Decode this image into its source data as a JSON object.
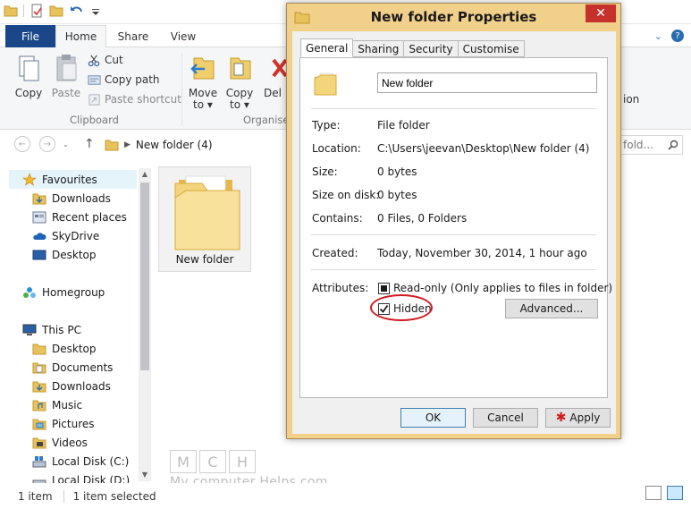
{
  "explorer": {
    "ribbon_tabs": [
      "File",
      "Home",
      "Share",
      "View"
    ],
    "clipboard": {
      "copy": "Copy",
      "paste": "Paste",
      "cut": "Cut",
      "copy_path": "Copy path",
      "paste_shortcut": "Paste shortcut",
      "group_label": "Clipboard"
    },
    "organise": {
      "move_to_1": "Move",
      "move_to_2": "to ▾",
      "copy_to_1": "Copy",
      "copy_to_2": "to ▾",
      "delete": "Del",
      "group_label": "Organise"
    },
    "right_partial": "ion",
    "address": {
      "path": "New folder (4)"
    },
    "search": {
      "placeholder": "fold..."
    },
    "nav": {
      "favourites": "Favourites",
      "downloads": "Downloads",
      "recent": "Recent places",
      "skydrive": "SkyDrive",
      "desktop": "Desktop",
      "homegroup": "Homegroup",
      "this_pc": "This PC",
      "pc_desktop": "Desktop",
      "pc_documents": "Documents",
      "pc_downloads": "Downloads",
      "pc_music": "Music",
      "pc_pictures": "Pictures",
      "pc_videos": "Videos",
      "local_c": "Local Disk (C:)",
      "local_d": "Local Disk (D:)"
    },
    "files": [
      {
        "name": "New folder"
      }
    ],
    "status": {
      "count": "1 item",
      "selected": "1 item selected"
    },
    "watermark": {
      "letters": [
        "M",
        "C",
        "H"
      ],
      "text": "My computer Helps.com"
    }
  },
  "dialog": {
    "title": "New folder Properties",
    "tabs": [
      "General",
      "Sharing",
      "Security",
      "Customise"
    ],
    "name_value": "New folder",
    "props": {
      "type_label": "Type:",
      "type_value": "File folder",
      "location_label": "Location:",
      "location_value": "C:\\Users\\jeevan\\Desktop\\New folder (4)",
      "size_label": "Size:",
      "size_value": "0 bytes",
      "size_on_disk_label": "Size on disk:",
      "size_on_disk_value": "0 bytes",
      "contains_label": "Contains:",
      "contains_value": "0 Files, 0 Folders",
      "created_label": "Created:",
      "created_value": "Today, November 30, 2014, 1 hour ago",
      "attributes_label": "Attributes:"
    },
    "attributes": {
      "readonly_label": "Read-only (Only applies to files in folder)",
      "hidden_label": "Hidden",
      "advanced_label": "Advanced..."
    },
    "buttons": {
      "ok": "OK",
      "cancel": "Cancel",
      "apply": "Apply"
    }
  },
  "colors": {
    "accent": "#19478a",
    "dialog_frame": "#f1d08a",
    "highlight_oval": "#d2191f"
  }
}
